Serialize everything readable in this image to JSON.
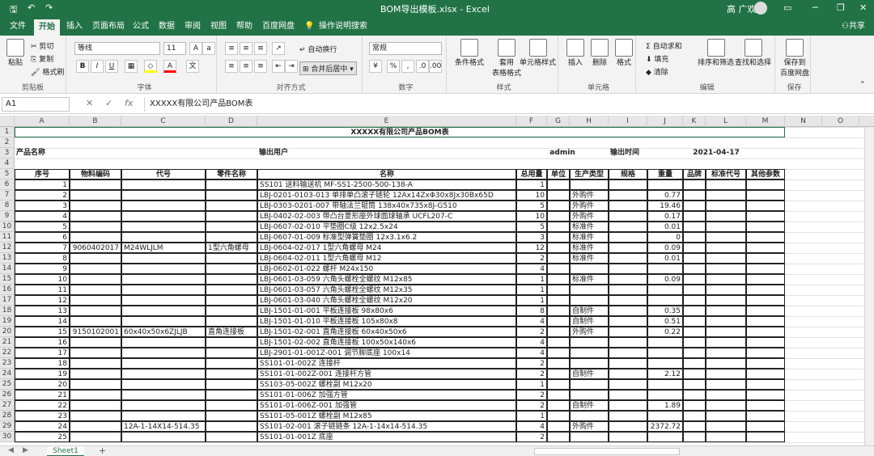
{
  "window": {
    "title": "BOM导出模板.xlsx - Excel",
    "user": "高 广欢"
  },
  "ribbon_tabs": [
    "文件",
    "开始",
    "插入",
    "页面布局",
    "公式",
    "数据",
    "审阅",
    "视图",
    "帮助",
    "百度网盘",
    "操作说明搜索"
  ],
  "share_label": "共享",
  "ribbon": {
    "clipboard": {
      "paste": "粘贴",
      "cut": "剪切",
      "copy": "复制",
      "painter": "格式刷",
      "label": "剪贴板"
    },
    "font": {
      "name": "等线",
      "size": "11",
      "bold": "B",
      "italic": "I",
      "underline": "U",
      "label": "字体"
    },
    "align": {
      "wrap": "自动换行",
      "merge": "合并后居中",
      "label": "对齐方式"
    },
    "number": {
      "format": "常规",
      "percent": "%",
      "comma": ",",
      "label": "数字"
    },
    "styles": {
      "cond": "条件格式",
      "table1": "套用",
      "table2": "表格格式",
      "cell_style": "单元格样式",
      "label": "样式"
    },
    "cells": {
      "insert": "插入",
      "delete": "删除",
      "format": "格式",
      "label": "单元格"
    },
    "edit": {
      "autosum": "自动求和",
      "fill": "填充",
      "clear": "清除",
      "sort": "排序和筛选",
      "find": "查找和选择",
      "label": "编辑"
    },
    "save": {
      "line1": "保存到",
      "line2": "百度网盘",
      "label": "保存"
    }
  },
  "formula_bar": {
    "cell_ref": "A1",
    "cancel": "✕",
    "confirm": "✓",
    "fx": "fx",
    "content": "XXXXX有限公司产品BOM表"
  },
  "columns": [
    "A",
    "B",
    "C",
    "D",
    "E",
    "F",
    "G",
    "H",
    "I",
    "J",
    "K",
    "L",
    "M",
    "N",
    "O"
  ],
  "rows": [
    "1",
    "2",
    "3",
    "4",
    "5",
    "6",
    "7",
    "8",
    "9",
    "10",
    "11",
    "12",
    "13",
    "14",
    "15",
    "16",
    "17",
    "18",
    "19",
    "20",
    "21",
    "22",
    "23",
    "24",
    "25",
    "26",
    "27",
    "28",
    "29",
    "30"
  ],
  "sheet": {
    "title": "XXXXX有限公司产品BOM表",
    "meta": {
      "product_label": "产品名称",
      "user_label": "输出用户",
      "user_value": "admin",
      "time_label": "输出时间",
      "time_value": "2021-04-17"
    },
    "headers": [
      "序号",
      "物料编码",
      "代号",
      "零件名称",
      "名称",
      "总用量",
      "单位",
      "生产类型",
      "规格",
      "重量",
      "品牌",
      "标准代号",
      "其他参数"
    ],
    "data": [
      [
        "1",
        "",
        "",
        "",
        "SS101 送料输送机 MF-SS1-2500-500-138-A",
        "1",
        "",
        "",
        "",
        ""
      ],
      [
        "2",
        "",
        "",
        "",
        "LBJ-0201-0103-013 单排单凸滚子链轮 12Ax14ZxΦ30x8Jx30Bx65D",
        "10",
        "",
        "外购件",
        "",
        "0.77"
      ],
      [
        "3",
        "",
        "",
        "",
        "LBJ-0303-0201-007 带轴法兰辊筒 138x40x735x8J-G510",
        "5",
        "",
        "外购件",
        "",
        "19.46"
      ],
      [
        "4",
        "",
        "",
        "",
        "LBJ-0402-02-003 带凸台菱形座外球面球轴承 UCFL207-C",
        "10",
        "",
        "外购件",
        "",
        "0.17"
      ],
      [
        "5",
        "",
        "",
        "",
        "LBJ-0607-02-010 平垫圈C级 12x2.5x24",
        "5",
        "",
        "标准件",
        "",
        "0.01"
      ],
      [
        "6",
        "",
        "",
        "",
        "LBJ-0607-01-009 标准型弹簧垫圈 12x3.1x6.2",
        "3",
        "",
        "标准件",
        "",
        "0"
      ],
      [
        "7",
        "9060402017",
        "M24WLJLM",
        "1型六角螺母",
        "LBJ-0604-02-017 1型六角螺母 M24",
        "12",
        "",
        "标准件",
        "",
        "0.09"
      ],
      [
        "8",
        "",
        "",
        "",
        "LBJ-0604-02-011 1型六角螺母 M12",
        "2",
        "",
        "标准件",
        "",
        "0.01"
      ],
      [
        "9",
        "",
        "",
        "",
        "LBJ-0602-01-022 螺杆 M24x150",
        "4",
        "",
        "",
        "",
        ""
      ],
      [
        "10",
        "",
        "",
        "",
        "LBJ-0601-03-059 六角头螺栓全螺纹 M12x85",
        "1",
        "",
        "标准件",
        "",
        "0.09"
      ],
      [
        "11",
        "",
        "",
        "",
        "LBJ-0601-03-057 六角头螺栓全螺纹 M12x35",
        "1",
        "",
        "",
        "",
        ""
      ],
      [
        "12",
        "",
        "",
        "",
        "LBJ-0601-03-040 六角头螺栓全螺纹 M12x20",
        "1",
        "",
        "",
        "",
        ""
      ],
      [
        "13",
        "",
        "",
        "",
        "LBJ-1501-01-001 平板连接板 98x80x6",
        "8",
        "",
        "自制件",
        "",
        "0.35"
      ],
      [
        "14",
        "",
        "",
        "",
        "LBJ-1501-01-010 平板连接板 105x80x8",
        "4",
        "",
        "自制件",
        "",
        "0.51"
      ],
      [
        "15",
        "9150102001",
        "60x40x50x6ZJLJB",
        "直角连接板",
        "LBJ-1501-02-001 直角连接板 60x40x50x6",
        "2",
        "",
        "外购件",
        "",
        "0.22"
      ],
      [
        "16",
        "",
        "",
        "",
        "LBJ-1501-02-002 直角连接板 100x50x140x6",
        "4",
        "",
        "",
        "",
        ""
      ],
      [
        "17",
        "",
        "",
        "",
        "LBJ-2901-01-001Z-001 调节脚底座 100x14",
        "4",
        "",
        "",
        "",
        ""
      ],
      [
        "18",
        "",
        "",
        "",
        "SS101-01-002Z 连接杆",
        "2",
        "",
        "",
        "",
        ""
      ],
      [
        "19",
        "",
        "",
        "",
        "SS101-01-002Z-001 连接杆方管",
        "2",
        "",
        "自制件",
        "",
        "2.12"
      ],
      [
        "20",
        "",
        "",
        "",
        "SS103-05-002Z 螺栓副 M12x20",
        "1",
        "",
        "",
        "",
        ""
      ],
      [
        "21",
        "",
        "",
        "",
        "SS101-01-006Z 加强方管",
        "2",
        "",
        "",
        "",
        ""
      ],
      [
        "22",
        "",
        "",
        "",
        "SS101-01-006Z-001 加强管",
        "2",
        "",
        "自制件",
        "",
        "1.89"
      ],
      [
        "23",
        "",
        "",
        "",
        "SS101-05-001Z 螺栓副 M12x85",
        "1",
        "",
        "",
        "",
        ""
      ],
      [
        "24",
        "",
        "12A-1-14X14-514.35",
        "",
        "SS101-02-001 滚子链链条 12A-1-14x14-514.35",
        "4",
        "",
        "外购件",
        "",
        "2372.72"
      ],
      [
        "25",
        "",
        "",
        "",
        "SS101-01-001Z 底座",
        "2",
        "",
        "",
        "",
        ""
      ]
    ]
  },
  "status": {
    "sheet_name": "Sheet1",
    "add": "+"
  }
}
